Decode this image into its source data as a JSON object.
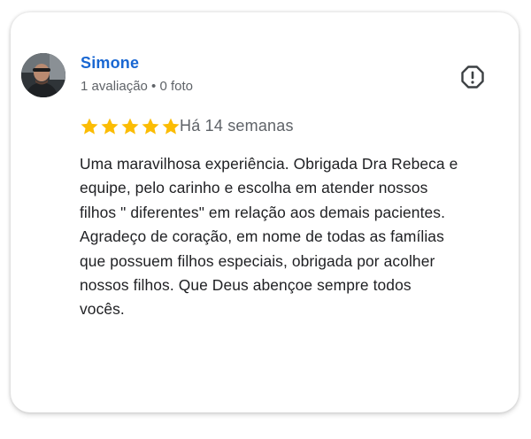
{
  "review": {
    "author_name": "Simone",
    "author_meta": "1 avaliação • 0 foto",
    "rating": 5,
    "rating_max": 5,
    "time_ago": "Há 14 semanas",
    "text": "Uma maravilhosa experiência. Obrigada Dra Rebeca e\nequipe, pelo carinho e escolha em atender nossos\nfilhos \" diferentes\" em relação aos demais pacientes.\nAgradeço de coração, em nome de todas as famílias\nque possuem filhos especiais, obrigada por acolher\nnossos filhos. Que Deus abençoe sempre todos\nvocês.",
    "report_icon": "report-flag-icon",
    "star_icon": "star-icon"
  },
  "colors": {
    "author_name": "#1967d2",
    "star_filled": "#fbbc04",
    "secondary_text": "#5f6368",
    "body_text": "#202124"
  }
}
